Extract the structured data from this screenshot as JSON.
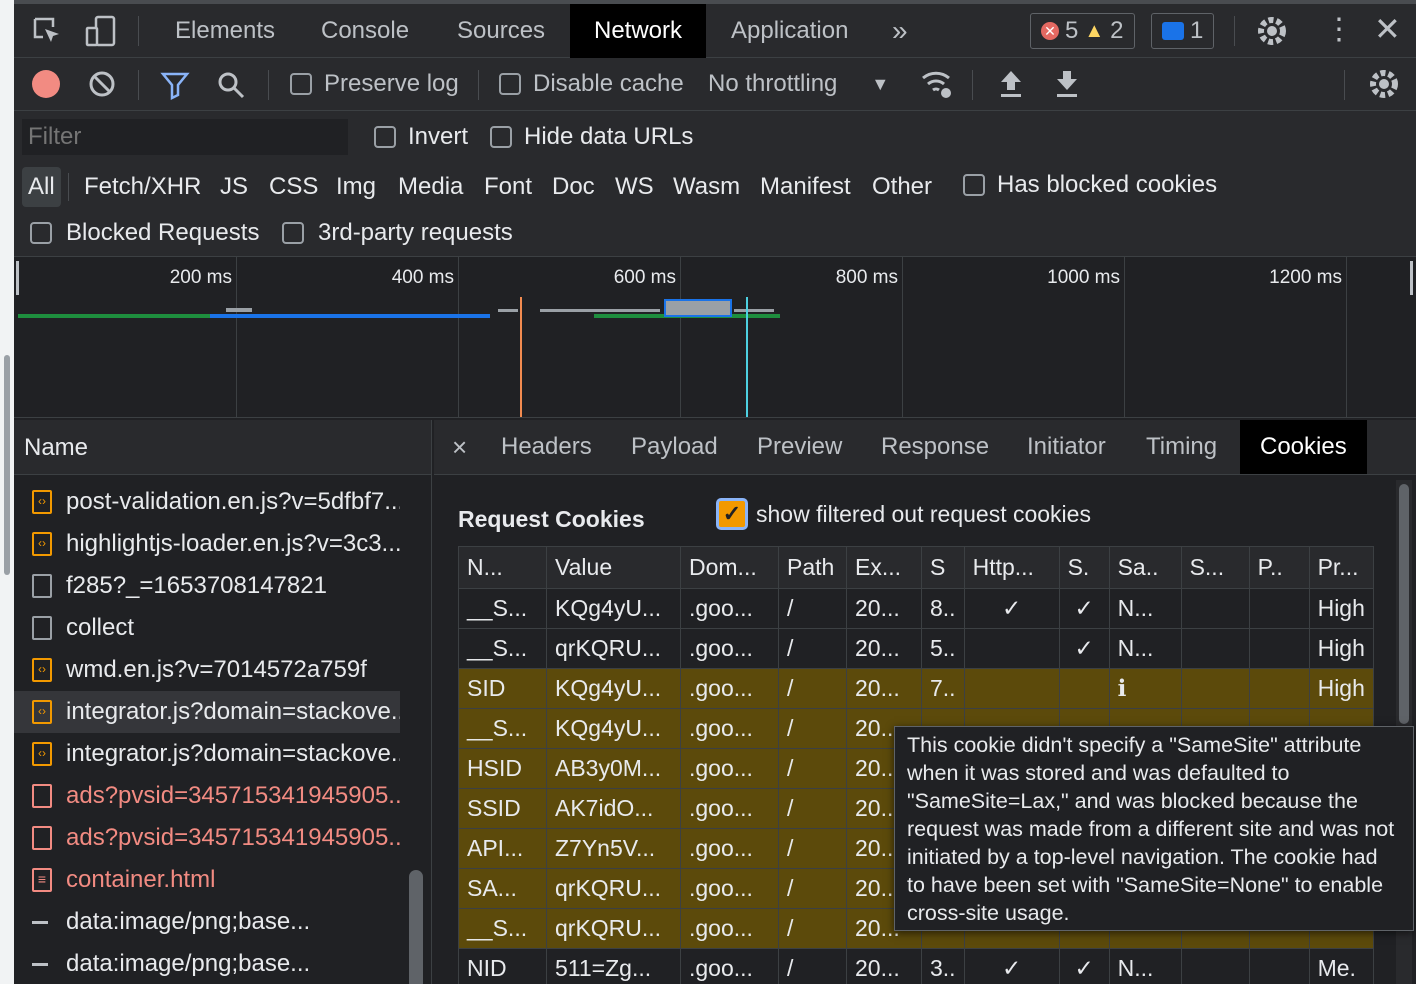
{
  "top_tabs": [
    "Elements",
    "Console",
    "Sources",
    "Network",
    "Application"
  ],
  "overflow_label": "»",
  "badges": {
    "errors": "5",
    "warnings": "2",
    "messages": "1"
  },
  "toolbar": {
    "preserve_log": "Preserve log",
    "disable_cache": "Disable cache",
    "throttling": "No throttling"
  },
  "filter": {
    "placeholder": "Filter",
    "invert": "Invert",
    "hide_data_urls": "Hide data URLs",
    "types": [
      "All",
      "Fetch/XHR",
      "JS",
      "CSS",
      "Img",
      "Media",
      "Font",
      "Doc",
      "WS",
      "Wasm",
      "Manifest",
      "Other"
    ],
    "has_blocked_cookies": "Has blocked cookies",
    "blocked_requests": "Blocked Requests",
    "third_party": "3rd-party requests"
  },
  "overview": {
    "ticks": [
      "200 ms",
      "400 ms",
      "600 ms",
      "800 ms",
      "1000 ms",
      "1200 ms"
    ]
  },
  "name_column": {
    "header": "Name",
    "requests": [
      "post-validation.en.js?v=5dfbf7...",
      "highlightjs-loader.en.js?v=3c3...",
      "f285?_=1653708147821",
      "collect",
      "wmd.en.js?v=7014572a759f",
      "integrator.js?domain=stackove...",
      "integrator.js?domain=stackove...",
      "ads?pvsid=345715341945905...",
      "ads?pvsid=345715341945905...",
      "container.html",
      "data:image/png;base...",
      "data:image/png;base..."
    ]
  },
  "detail_tabs": [
    "×",
    "Headers",
    "Payload",
    "Preview",
    "Response",
    "Initiator",
    "Timing",
    "Cookies"
  ],
  "cookies": {
    "section_title": "Request Cookies",
    "show_filtered": "show filtered out request cookies",
    "columns": [
      "N...",
      "Value",
      "Dom...",
      "Path",
      "Ex...",
      "S",
      "Http...",
      "S.",
      "Sa..",
      "S...",
      "P..",
      "Pr..."
    ],
    "rows": [
      [
        "__S...",
        "KQg4yU...",
        ".goo...",
        "/",
        "20...",
        "8..",
        "✓",
        "✓",
        "N...",
        "",
        "",
        "High"
      ],
      [
        "__S...",
        "qrKQRU...",
        ".goo...",
        "/",
        "20...",
        "5..",
        "",
        "✓",
        "N...",
        "",
        "",
        "High"
      ],
      [
        "SID",
        "KQg4yU...",
        ".goo...",
        "/",
        "20...",
        "7..",
        "",
        "",
        "ℹ",
        "",
        "",
        "High"
      ],
      [
        "__S...",
        "KQg4yU...",
        ".goo...",
        "/",
        "20...",
        "",
        "",
        "",
        "",
        "",
        "",
        ""
      ],
      [
        "HSID",
        "AB3y0M...",
        ".goo...",
        "/",
        "20...",
        "",
        "",
        "",
        "",
        "",
        "",
        ""
      ],
      [
        "SSID",
        "AK7idO...",
        ".goo...",
        "/",
        "20...",
        "",
        "",
        "",
        "",
        "",
        "",
        ""
      ],
      [
        "API...",
        "Z7Yn5V...",
        ".goo...",
        "/",
        "20...",
        "",
        "",
        "",
        "",
        "",
        "",
        ""
      ],
      [
        "SA...",
        "qrKQRU...",
        ".goo...",
        "/",
        "20...",
        "",
        "",
        "",
        "",
        "",
        "",
        ""
      ],
      [
        "__S...",
        "qrKQRU...",
        ".goo...",
        "/",
        "20...",
        "",
        "",
        "",
        "",
        "",
        "",
        ""
      ],
      [
        "NID",
        "511=Zg...",
        ".goo...",
        "/",
        "20...",
        "3..",
        "✓",
        "✓",
        "N...",
        "",
        "",
        "Me."
      ]
    ],
    "tooltip": "This cookie didn't specify a \"SameSite\" attribute when it was stored and was defaulted to \"SameSite=Lax,\" and was blocked because the request was made from a different site and was not initiated by a top-level navigation. The cookie had to have been set with \"SameSite=None\" to enable cross-site usage."
  }
}
